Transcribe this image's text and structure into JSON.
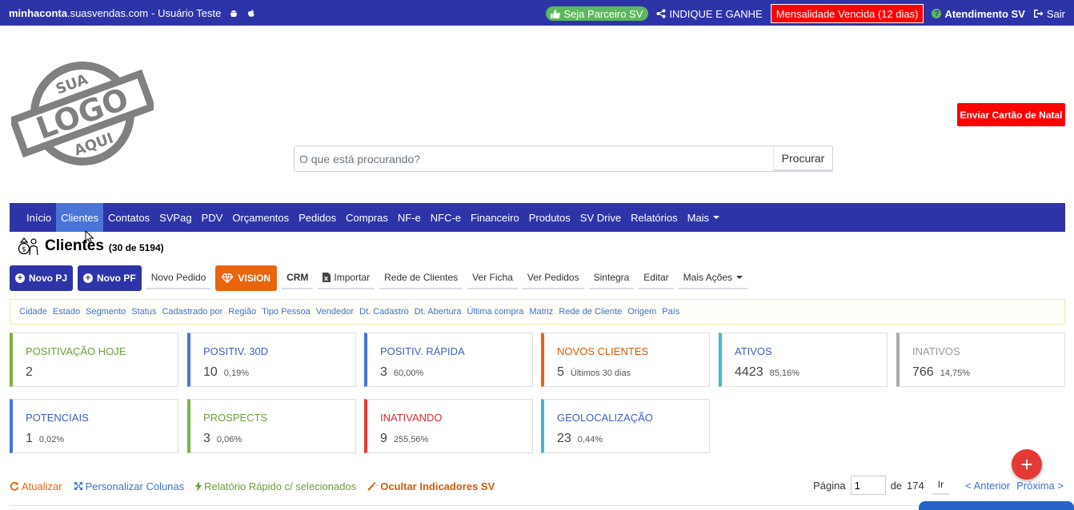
{
  "topbar": {
    "domain_bold": "minhaconta",
    "domain_rest": ".suasvendas.com",
    "user": " - Usuário Teste",
    "partner": "Seja Parceiro SV",
    "refer": "INDIQUE E GANHE",
    "overdue": "Mensalidade Vencida (12 dias)",
    "support": "Atendimento SV",
    "logout": "Sair"
  },
  "xmas_button": "Enviar Cartão de Natal",
  "search": {
    "placeholder": "O que está procurando?",
    "button": "Procurar"
  },
  "nav": [
    "Início",
    "Clientes",
    "Contatos",
    "SVPag",
    "PDV",
    "Orçamentos",
    "Pedidos",
    "Compras",
    "NF-e",
    "NFC-e",
    "Financeiro",
    "Produtos",
    "SV Drive",
    "Relatórios",
    "Mais"
  ],
  "page": {
    "title": "Clientes",
    "count": "(30 de 5194)"
  },
  "actions": {
    "novo_pj": "Novo PJ",
    "novo_pf": "Novo PF",
    "novo_pedido": "Novo Pedido",
    "vision": "VISION",
    "crm": "CRM",
    "importar": "Importar",
    "rede": "Rede de Clientes",
    "ver_ficha": "Ver Ficha",
    "ver_pedidos": "Ver Pedidos",
    "sintegra": "Sintegra",
    "editar": "Editar",
    "mais_acoes": "Mais Ações"
  },
  "filters": [
    "Cidade",
    "Estado",
    "Segmento",
    "Status",
    "Cadastrado por",
    "Região",
    "Tipo Pessoa",
    "Vendedor",
    "Dt. Cadastro",
    "Dt. Abertura",
    "Última compra",
    "Matriz",
    "Rede de Cliente",
    "Origem",
    "País"
  ],
  "cards": [
    {
      "label": "POSITIVAÇÃO HOJE",
      "value": "2",
      "sub": ""
    },
    {
      "label": "POSITIV. 30D",
      "value": "10",
      "sub": "0,19%"
    },
    {
      "label": "POSITIV. RÁPIDA",
      "value": "3",
      "sub": "60,00%"
    },
    {
      "label": "NOVOS CLIENTES",
      "value": "5",
      "sub": "Últimos 30 dias"
    },
    {
      "label": "ATIVOS",
      "value": "4423",
      "sub": "85,16%"
    },
    {
      "label": "INATIVOS",
      "value": "766",
      "sub": "14,75%"
    },
    {
      "label": "POTENCIAIS",
      "value": "1",
      "sub": "0,02%"
    },
    {
      "label": "PROSPECTS",
      "value": "3",
      "sub": "0,06%"
    },
    {
      "label": "INATIVANDO",
      "value": "9",
      "sub": "255,56%"
    },
    {
      "label": "GEOLOCALIZAÇÃO",
      "value": "23",
      "sub": "0,44%"
    }
  ],
  "bottom": {
    "atualizar": "Atualizar",
    "personalizar": "Personalizar Colunas",
    "relatorio": "Relatório Rápido c/ selecionados",
    "ocultar": "Ocultar Indicadores SV"
  },
  "pager": {
    "label": "Página",
    "page": "1",
    "of": "de",
    "total": "174",
    "go": "Ir",
    "prev": "< Anterior",
    "next": "Próxima >"
  },
  "colors": {
    "primary": "#2d34a8",
    "danger": "#ff0000",
    "orange": "#e8650d",
    "green": "#5cb85c"
  }
}
